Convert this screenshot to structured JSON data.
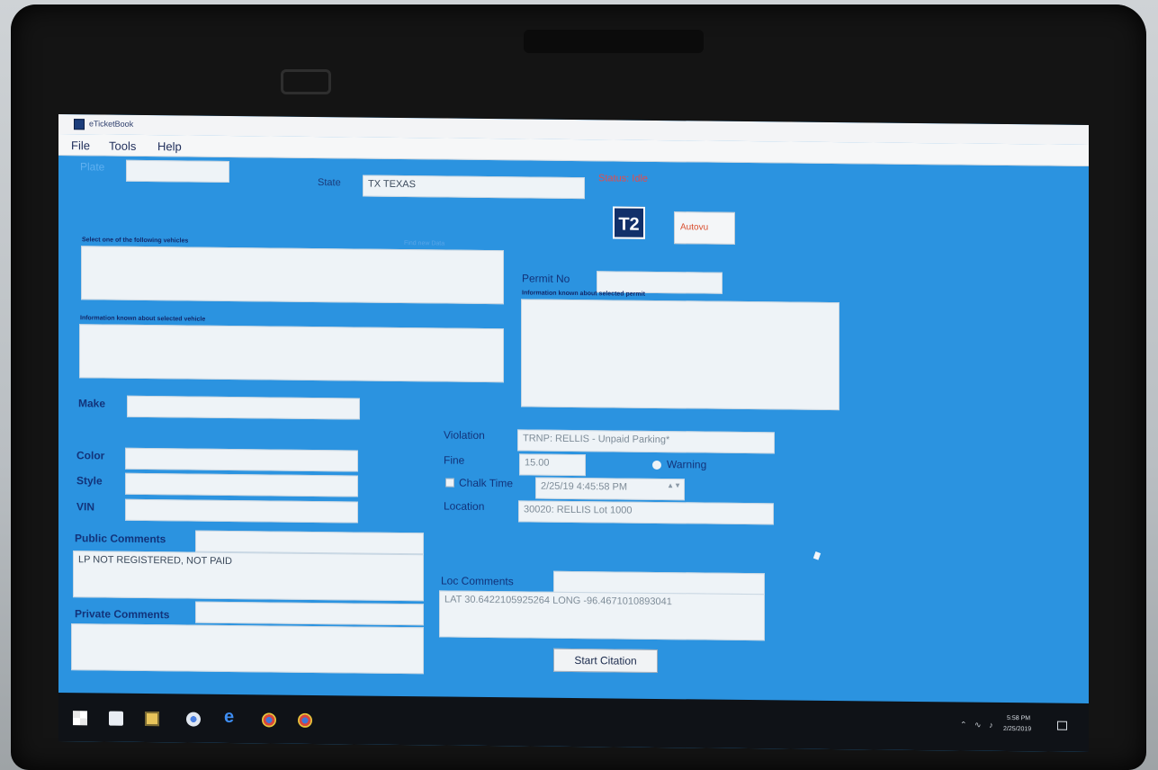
{
  "window": {
    "title": "eTicketBook"
  },
  "menu": [
    "File",
    "Tools",
    "Help"
  ],
  "form": {
    "plate_label": "Plate",
    "plate_value": "",
    "state_label": "State",
    "state_value": "TX TEXAS",
    "status_text": "Status: Idle",
    "logo_t2": "T2",
    "autovu_label": "Autovu",
    "select_vehicle_label": "Select one of the following vehicles",
    "find_new_note": "Find new Data",
    "permit_label": "Permit No",
    "permit_value": "",
    "permit_info_label": "Information known about selected permit",
    "vehicle_info_label": "Information known about selected vehicle",
    "make_label": "Make",
    "color_label": "Color",
    "style_label": "Style",
    "vin_label": "VIN",
    "violation_label": "Violation",
    "violation_value": "TRNP: RELLIS - Unpaid Parking*",
    "fine_label": "Fine",
    "fine_value": "15.00",
    "warning_label": "Warning",
    "chalk_time_label": "Chalk Time",
    "chalk_time_value": "2/25/19  4:45:58 PM",
    "location_label": "Location",
    "location_value": "30020: RELLIS Lot 1000",
    "public_comments_label": "Public Comments",
    "public_comments_value": "LP NOT REGISTERED, NOT PAID",
    "private_comments_label": "Private Comments",
    "loc_comments_label": "Loc Comments",
    "loc_comments_value": "LAT 30.6422105925264 LONG -96.4671010893041",
    "start_citation_label": "Start Citation"
  },
  "taskbar": {
    "tray_icons": [
      "chevron-up-icon",
      "wifi-icon",
      "speaker-icon"
    ],
    "time": "5:58 PM",
    "date": "2/25/2019"
  }
}
